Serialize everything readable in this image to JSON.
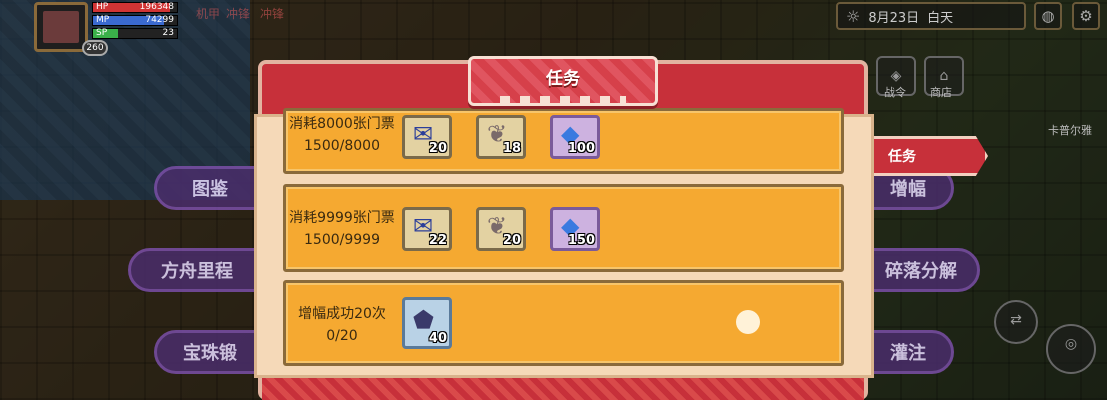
{
  "player": {
    "hp_label": "HP",
    "hp_value": "196348",
    "hp_fraction": 0.92,
    "mp_label": "MP",
    "mp_value": "74299",
    "mp_fraction": 0.85,
    "sp_label": "SP",
    "sp_value": "23",
    "sp_fraction": 0.3,
    "level": "260"
  },
  "top_tags": [
    "机甲",
    "冲锋",
    "冲锋"
  ],
  "date": {
    "text": "8月23日",
    "period": "白天"
  },
  "side_menu_left": [
    "图鉴",
    "方舟里程",
    "宝珠锻"
  ],
  "side_menu_right": [
    "增幅",
    "碎落分解",
    "灌注"
  ],
  "task_tab": "任务",
  "panel": {
    "title": "任务"
  },
  "side_icon_labels": [
    "战令",
    "商店",
    "卡普尔雅"
  ],
  "tasks": [
    {
      "desc_line1": "消耗8000张门票",
      "progress": "1500/8000",
      "rewards": [
        {
          "icon": "blue-scroll-icon",
          "qty": "20",
          "style": "plain"
        },
        {
          "icon": "winged-pouch-icon",
          "qty": "18",
          "style": "plain"
        },
        {
          "icon": "diamond-icon",
          "qty": "100",
          "style": "purple"
        }
      ]
    },
    {
      "desc_line1": "消耗9999张门票",
      "progress": "1500/9999",
      "rewards": [
        {
          "icon": "blue-scroll-icon",
          "qty": "22",
          "style": "plain"
        },
        {
          "icon": "winged-pouch-icon",
          "qty": "20",
          "style": "plain"
        },
        {
          "icon": "diamond-icon",
          "qty": "150",
          "style": "purple"
        }
      ]
    },
    {
      "desc_line1": "增幅成功20次",
      "progress": "0/20",
      "rewards": [
        {
          "icon": "crystal-icon",
          "qty": "40",
          "style": "blue"
        }
      ]
    }
  ]
}
